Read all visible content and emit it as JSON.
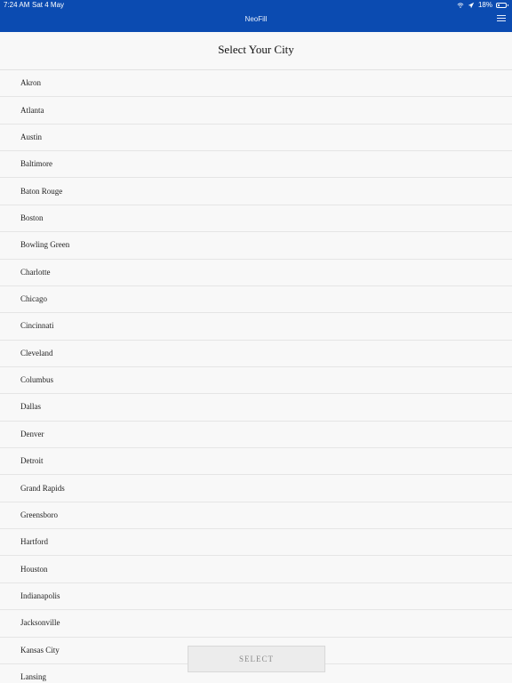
{
  "status_bar": {
    "time": "7:24 AM",
    "date": "Sat 4 May",
    "battery": "18%",
    "wifi_icon": "wifi-icon",
    "location_icon": "location-icon",
    "battery_icon": "battery-icon"
  },
  "header": {
    "app_title": "NeoFill",
    "menu_icon": "menu-icon"
  },
  "page": {
    "title": "Select Your City"
  },
  "cities": [
    "Akron",
    "Atlanta",
    "Austin",
    "Baltimore",
    "Baton Rouge",
    "Boston",
    "Bowling Green",
    "Charlotte",
    "Chicago",
    "Cincinnati",
    "Cleveland",
    "Columbus",
    "Dallas",
    "Denver",
    "Detroit",
    "Grand Rapids",
    "Greensboro",
    "Hartford",
    "Houston",
    "Indianapolis",
    "Jacksonville",
    "Kansas City",
    "Lansing"
  ],
  "actions": {
    "select_label": "SELECT"
  },
  "colors": {
    "header_background": "#0b4bb1",
    "page_background": "#f8f8f8",
    "divider": "#e5e5e5",
    "button_background": "#ececec"
  }
}
